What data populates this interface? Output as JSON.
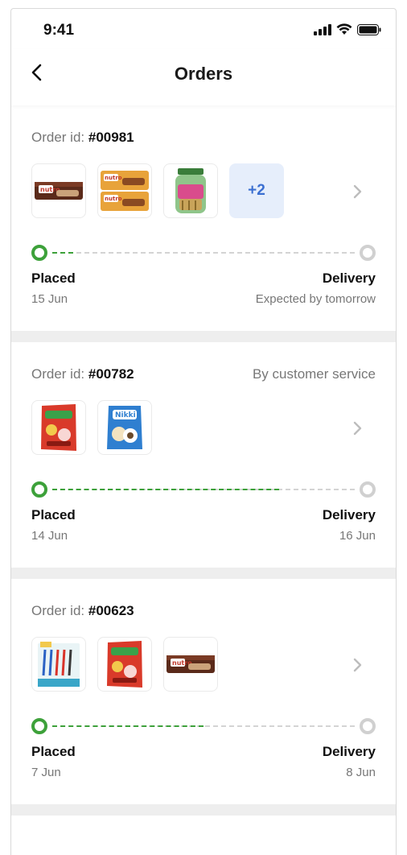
{
  "status_bar": {
    "time": "9:41"
  },
  "nav": {
    "title": "Orders"
  },
  "orders": [
    {
      "id_label": "Order id:",
      "id": "#00981",
      "note": "",
      "thumbs": [
        "nutro-wafer-bar",
        "nutro-twin-pack",
        "rolls-jar"
      ],
      "more_count": "+2",
      "progress": 0.07,
      "start_label": "Placed",
      "start_date": "15 Jun",
      "end_label": "Delivery",
      "end_date": "Expected by tomorrow"
    },
    {
      "id_label": "Order id:",
      "id": "#00782",
      "note": "By customer service",
      "thumbs": [
        "red-candy-pack",
        "nikki-biscuit-pack"
      ],
      "more_count": "",
      "progress": 0.75,
      "start_label": "Placed",
      "start_date": "14 Jun",
      "end_label": "Delivery",
      "end_date": "16 Jun"
    },
    {
      "id_label": "Order id:",
      "id": "#00623",
      "note": "",
      "thumbs": [
        "pen-box",
        "red-candy-pack",
        "nutro-wafer-bar"
      ],
      "more_count": "",
      "progress": 0.5,
      "start_label": "Placed",
      "start_date": "7 Jun",
      "end_label": "Delivery",
      "end_date": "8 Jun"
    }
  ],
  "colors": {
    "accent_green": "#3da13a",
    "track_gray": "#d4d4d4",
    "more_bg": "#e6eefb",
    "more_text": "#3b6fd1"
  },
  "icons": {
    "back": "chevron-left-icon",
    "row": "chevron-right-icon"
  }
}
